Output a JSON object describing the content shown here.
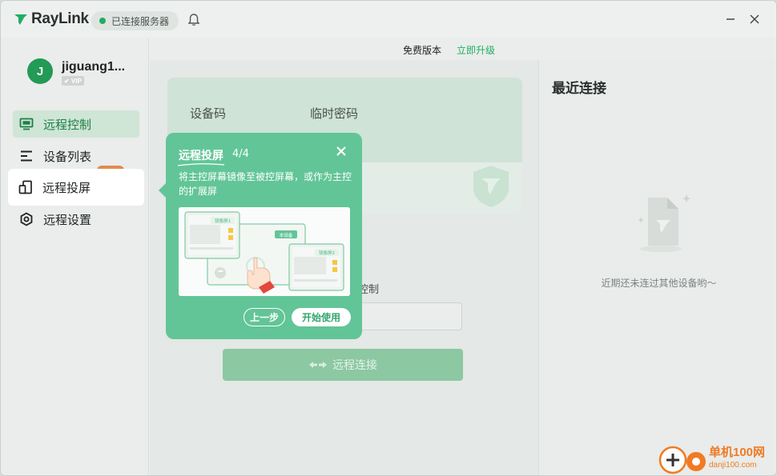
{
  "app": {
    "name": "RayLink",
    "connection_status": "已连接服务器",
    "status_color": "#1fae63"
  },
  "user": {
    "initial": "J",
    "name": "jiguang1...",
    "badge": "✔ VIP"
  },
  "sidebar": {
    "items": [
      {
        "label": "远程控制",
        "icon": "monitor-icon"
      },
      {
        "label": "设备列表",
        "icon": "list-icon"
      },
      {
        "label": "远程投屏",
        "icon": "screen-cast-icon"
      },
      {
        "label": "远程设置",
        "icon": "settings-hex-icon"
      }
    ],
    "footer_icons": [
      "message-icon",
      "feedback-icon",
      "compass-icon"
    ]
  },
  "topbar": {
    "version": "免费版本",
    "upgrade": "立即升级"
  },
  "device_card": {
    "device_code_label": "设备码",
    "temp_password_label": "临时密码"
  },
  "control": {
    "label_fragment": "控制",
    "connect_button": "远程连接"
  },
  "recent": {
    "title": "最近连接",
    "empty": "近期还未连过其他设备哟～"
  },
  "tip": {
    "title": "远程投屏",
    "step": "4/4",
    "description": "将主控屏幕镜像至被控屏幕，或作为主控的扩展屏",
    "illustration": {
      "mirror1": "镜像屏1",
      "local": "本设备",
      "mirror2": "镜像屏2"
    },
    "prev_button": "上一步",
    "start_button": "开始使用"
  },
  "watermark": {
    "line1": "单机100网",
    "line2": "danji100.com"
  },
  "colors": {
    "accent": "#1fae63",
    "tip_bg": "#62c597",
    "active_nav_bg": "#cfe5d6"
  }
}
